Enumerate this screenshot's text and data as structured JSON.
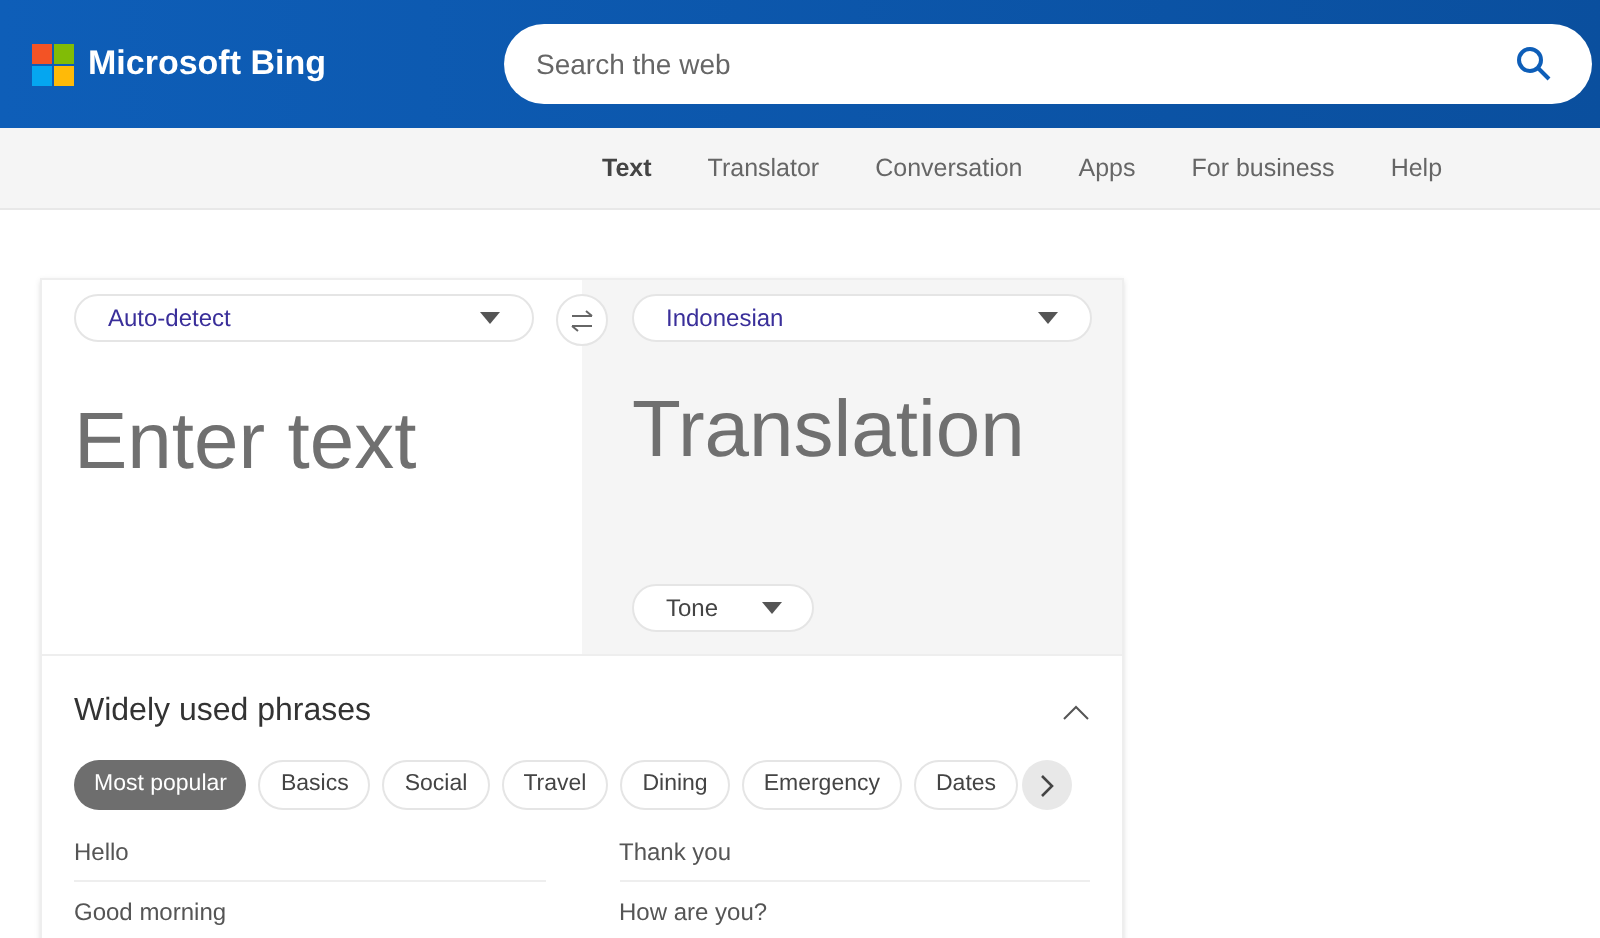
{
  "header": {
    "brand": "Microsoft Bing",
    "search": {
      "placeholder": "Search the web"
    }
  },
  "nav": [
    {
      "label": "Text",
      "selected": true
    },
    {
      "label": "Translator",
      "selected": false
    },
    {
      "label": "Conversation",
      "selected": false
    },
    {
      "label": "Apps",
      "selected": false
    },
    {
      "label": "For business",
      "selected": false
    },
    {
      "label": "Help",
      "selected": false
    }
  ],
  "translator": {
    "source_language": "Auto-detect",
    "target_language": "Indonesian",
    "input": {
      "placeholder": "Enter text"
    },
    "output": "Translation",
    "tone": "Tone"
  },
  "phrases": {
    "title": "Widely used phrases",
    "expanded": true,
    "categories": [
      {
        "label": "Most popular",
        "selected": true
      },
      {
        "label": "Basics",
        "selected": false
      },
      {
        "label": "Social",
        "selected": false
      },
      {
        "label": "Travel",
        "selected": false
      },
      {
        "label": "Dining",
        "selected": false
      },
      {
        "label": "Emergency",
        "selected": false
      },
      {
        "label": "Dates",
        "selected": false
      }
    ],
    "items": [
      "Hello",
      "Thank you",
      "Good morning",
      "How are you?"
    ]
  }
}
